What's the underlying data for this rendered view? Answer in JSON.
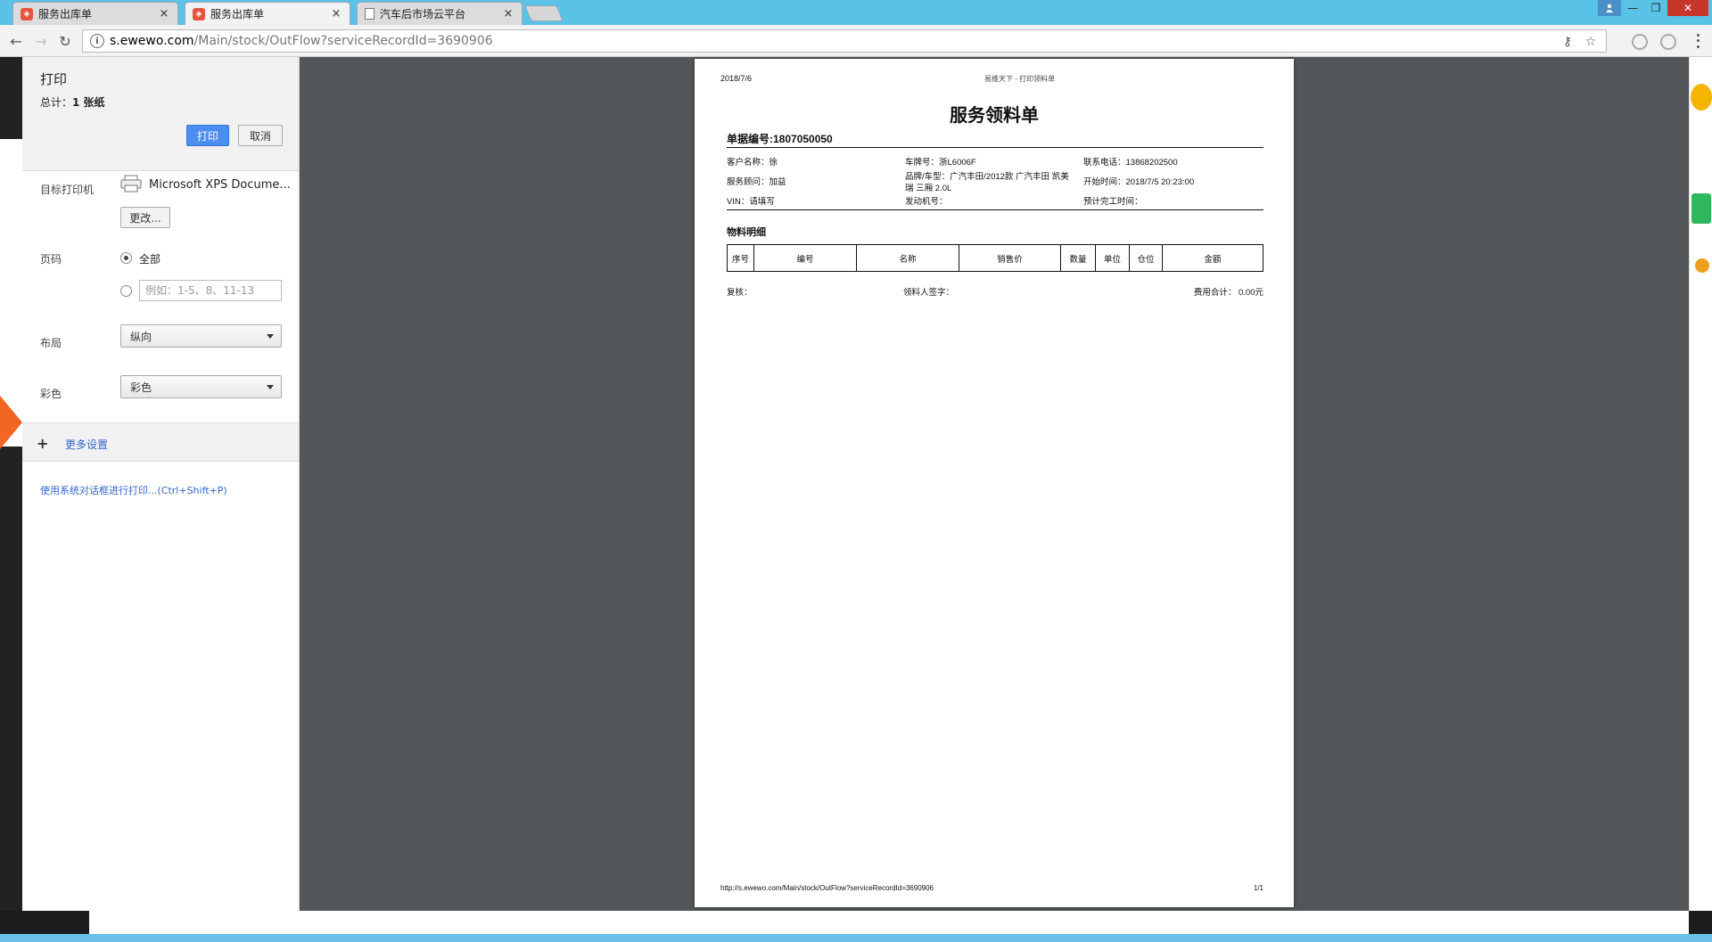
{
  "browser": {
    "tabs": [
      {
        "title": "服务出库单",
        "active": false
      },
      {
        "title": "服务出库单",
        "active": true
      },
      {
        "title": "汽车后市场云平台",
        "active": false
      }
    ],
    "url_host": "s.ewewo.com",
    "url_path": "/Main/stock/OutFlow?serviceRecordId=3690906",
    "window_buttons": {
      "minimize": "—",
      "maximize": "❐",
      "close": "✕"
    },
    "icons": {
      "back": "←",
      "forward": "→",
      "reload": "↻",
      "info": "i",
      "key": "⚷",
      "star": "☆",
      "close_tab": "×"
    }
  },
  "print_dialog": {
    "title": "打印",
    "summary_prefix": "总计：",
    "summary_value": "1 张纸",
    "print_button": "打印",
    "cancel_button": "取消",
    "destination_label": "目标打印机",
    "printer_name": "Microsoft XPS Docume...",
    "change_button": "更改...",
    "pages_label": "页码",
    "pages_all": "全部",
    "pages_placeholder": "例如：1-5、8、11-13",
    "layout_label": "布局",
    "layout_value": "纵向",
    "color_label": "彩色",
    "color_value": "彩色",
    "more_settings": "更多设置",
    "more_plus": "+",
    "system_dialog_link": "使用系统对话框进行打印...(Ctrl+Shift+P)"
  },
  "document": {
    "date": "2018/7/6",
    "header_title": "易维天下 - 打印领料单",
    "title": "服务领料单",
    "doc_no": "单据编号:1807050050",
    "fields": {
      "customer": "客户名称：徐",
      "plate": "车牌号：浙L6006F",
      "phone": "联系电话：13868202500",
      "advisor": "服务顾问：加益",
      "model_line1": "品牌/车型：广汽丰田/2012款 广汽丰田 凯美",
      "model_line2": "瑞 三厢 2.0L",
      "start_time": "开始时间：2018/7/5 20:23:00",
      "vin": "VIN：请填写",
      "engine": "发动机号：",
      "est_finish": "预计完工时间："
    },
    "section_title": "物料明细",
    "table_headers": [
      "序号",
      "编号",
      "名称",
      "销售价",
      "数量",
      "单位",
      "仓位",
      "金额"
    ],
    "review": "复核：",
    "signature": "领料人签字：",
    "total": "费用合计： 0.00元",
    "footer_url": "http://s.ewewo.com/Main/stock/OutFlow?serviceRecordId=3690906",
    "footer_page": "1/1"
  }
}
